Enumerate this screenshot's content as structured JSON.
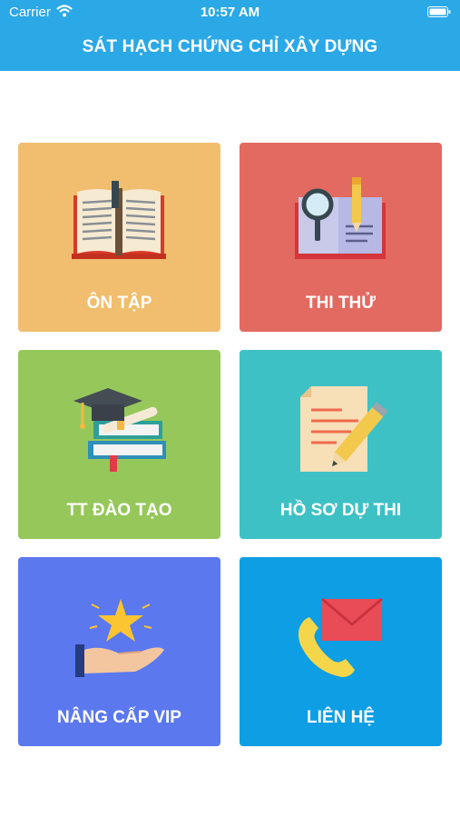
{
  "status_bar": {
    "carrier": "Carrier",
    "time": "10:57 AM"
  },
  "header": {
    "title": "SÁT HẠCH CHỨNG CHỈ XÂY DỰNG"
  },
  "tiles": [
    {
      "label": "ÔN TẬP",
      "color": "#f0be6e",
      "icon": "open-book-icon"
    },
    {
      "label": "THI THỬ",
      "color": "#e26a61",
      "icon": "magnifier-notebook-icon"
    },
    {
      "label": "TT ĐÀO TẠO",
      "color": "#96c75a",
      "icon": "graduation-books-icon"
    },
    {
      "label": "HỒ SƠ DỰ THI",
      "color": "#3ec1c5",
      "icon": "document-pencil-icon"
    },
    {
      "label": "NÂNG CẤP VIP",
      "color": "#5b78ef",
      "icon": "star-hand-icon"
    },
    {
      "label": "LIÊN HỆ",
      "color": "#0e9ee3",
      "icon": "phone-envelope-icon"
    }
  ]
}
